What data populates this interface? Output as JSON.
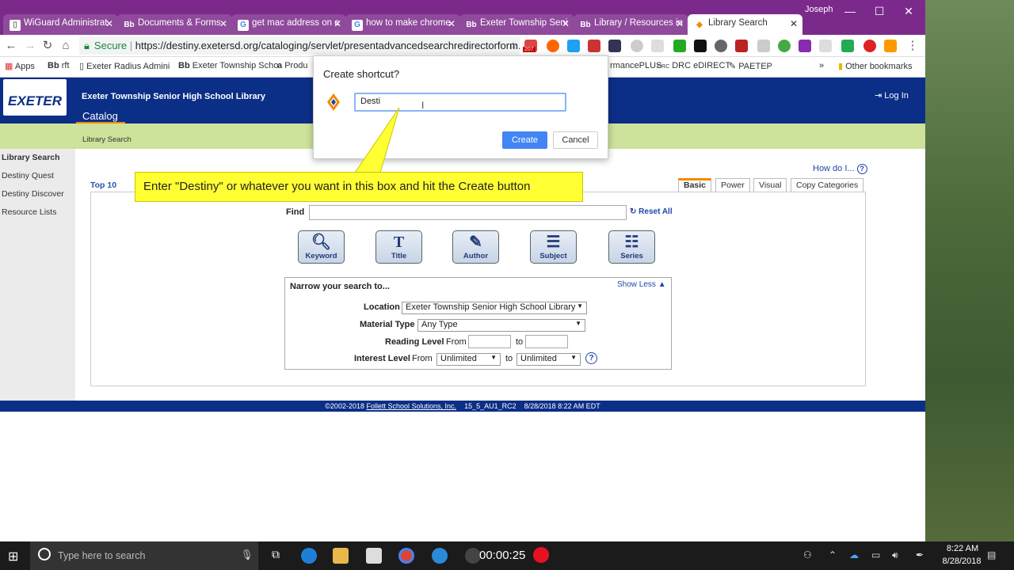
{
  "browser": {
    "tabs": [
      {
        "label": "WiGuard Administrat",
        "icon": "doc-icon"
      },
      {
        "label": "Documents & Forms",
        "icon": "bb-icon"
      },
      {
        "label": "get mac address on c",
        "icon": "google-icon"
      },
      {
        "label": "how to make chrome",
        "icon": "google-icon"
      },
      {
        "label": "Exeter Township Seni",
        "icon": "bb-icon"
      },
      {
        "label": "Library / Resources in",
        "icon": "bb-icon"
      },
      {
        "label": "Library Search",
        "icon": "destiny-icon",
        "active": true
      }
    ],
    "user": "Joseph",
    "secure_label": "Secure",
    "url": "https://destiny.exetersd.org/cataloging/servlet/presentadvancedsearchredirectorform.d...",
    "mail_badge": "207",
    "bookmarks": [
      "Apps",
      "rft",
      "Exeter Radius Admini",
      "Exeter Township Scho",
      "Produ",
      "rmancePLUS",
      "DRC eDIRECT",
      "PAETEP",
      "Other bookmarks"
    ]
  },
  "site": {
    "school_name": "Exeter Township Senior High School Library",
    "logo_text": "EXETER",
    "nav_tab": "Catalog",
    "login": "Log In",
    "sub_label": "Library Search"
  },
  "sidebar": {
    "items": [
      "Library Search",
      "Destiny Quest",
      "Destiny Discover",
      "Resource Lists"
    ]
  },
  "search": {
    "how_do_i": "How do I...",
    "top10": "Top 10",
    "tabs": [
      "Basic",
      "Power",
      "Visual",
      "Copy Categories"
    ],
    "find_label": "Find",
    "find_value": "",
    "reset_all": "Reset All",
    "buttons": [
      {
        "label": "Keyword",
        "icon": "magnifier-icon"
      },
      {
        "label": "Title",
        "icon": "title-t-icon"
      },
      {
        "label": "Author",
        "icon": "pencil-icon"
      },
      {
        "label": "Subject",
        "icon": "lines-icon"
      },
      {
        "label": "Series",
        "icon": "numbered-list-icon"
      }
    ],
    "narrow_title": "Narrow your search to...",
    "show_less": "Show Less",
    "location_label": "Location",
    "location_value": "Exeter Township Senior High School Library",
    "material_label": "Material Type",
    "material_value": "Any Type",
    "reading_label": "Reading Level",
    "from": "From",
    "to": "to",
    "interest_label": "Interest Level",
    "interest_from": "Unlimited",
    "interest_to": "Unlimited"
  },
  "footer": {
    "copyright": "©2002-2018",
    "company": "Follett School Solutions, Inc.",
    "build": "15_5_AU1_RC2",
    "timestamp": "8/28/2018 8:22 AM EDT"
  },
  "dialog": {
    "title": "Create shortcut?",
    "input_value": "Desti",
    "create": "Create",
    "cancel": "Cancel"
  },
  "callout": {
    "text": "Enter \"Destiny\" or whatever you want in this box and hit the Create button"
  },
  "taskbar": {
    "search_placeholder": "Type here to search",
    "rec_time": "00:00:25",
    "clock_time": "8:22 AM",
    "clock_date": "8/28/2018"
  }
}
